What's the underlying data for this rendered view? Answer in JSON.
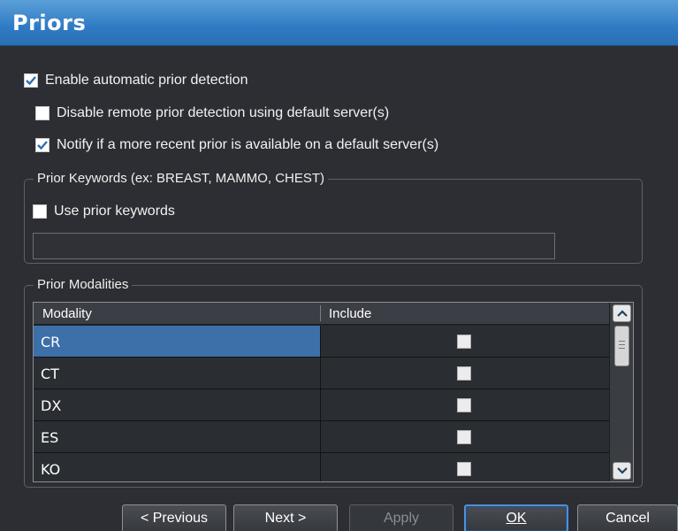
{
  "window": {
    "title": "Priors"
  },
  "options": {
    "enable_auto": {
      "label": "Enable automatic prior detection",
      "checked": true
    },
    "disable_remote": {
      "label": "Disable remote prior detection using default server(s)",
      "checked": false
    },
    "notify_recent": {
      "label": "Notify if a more recent prior is available on a default server(s)",
      "checked": true
    }
  },
  "keywords_group": {
    "label": "Prior Keywords (ex: BREAST, MAMMO, CHEST)",
    "use_keywords": {
      "label": "Use prior keywords",
      "checked": false
    },
    "keywords_value": ""
  },
  "modalities_group": {
    "label": "Prior Modalities",
    "columns": [
      "Modality",
      "Include"
    ],
    "rows": [
      {
        "modality": "CR",
        "include": false,
        "selected": true
      },
      {
        "modality": "CT",
        "include": false,
        "selected": false
      },
      {
        "modality": "DX",
        "include": false,
        "selected": false
      },
      {
        "modality": "ES",
        "include": false,
        "selected": false
      },
      {
        "modality": "KO",
        "include": false,
        "selected": false
      }
    ]
  },
  "buttons": {
    "previous": "< Previous",
    "next": "Next >",
    "apply": "Apply",
    "ok": "OK",
    "cancel": "Cancel"
  },
  "colors": {
    "title_bar": "#2f7bc4",
    "selection": "#3d6fa8",
    "background": "#2c2e33"
  }
}
